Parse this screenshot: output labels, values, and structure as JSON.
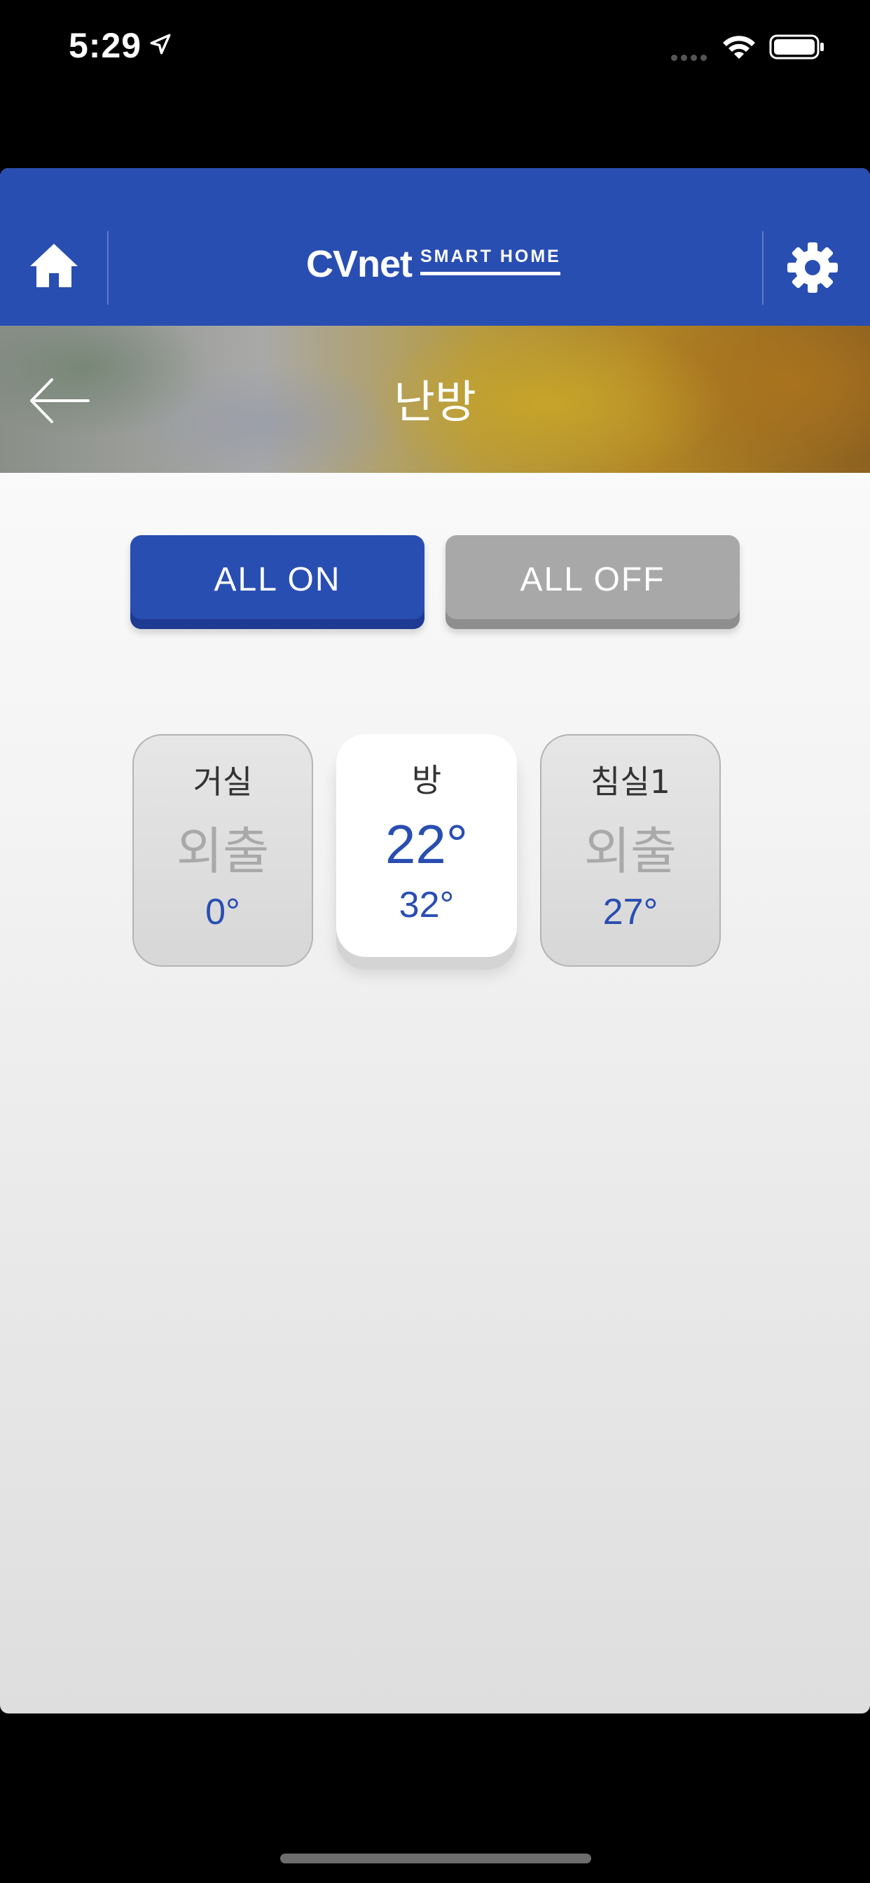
{
  "status": {
    "time": "5:29"
  },
  "header": {
    "logo_main": "CVnet",
    "logo_sub": "SMART HOME"
  },
  "page": {
    "title": "난방"
  },
  "actions": {
    "all_on": "ALL ON",
    "all_off": "ALL OFF"
  },
  "rooms": [
    {
      "name": "거실",
      "mode": "외출",
      "temp": "0°",
      "active": false
    },
    {
      "name": "방",
      "set_temp": "22°",
      "temp": "32°",
      "active": true
    },
    {
      "name": "침실1",
      "mode": "외출",
      "temp": "27°",
      "active": false
    }
  ],
  "colors": {
    "brand": "#294eb2",
    "inactive": "#a8a8a8"
  }
}
